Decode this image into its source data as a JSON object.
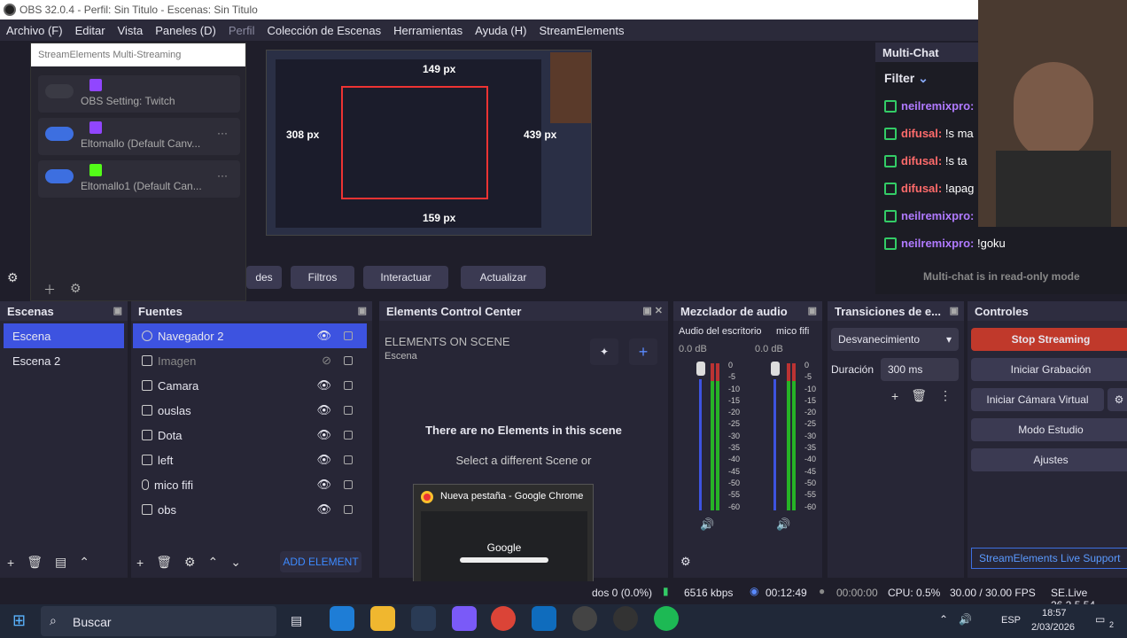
{
  "title": "OBS 32.0.4 - Perfil: Sin Titulo - Escenas: Sin Titulo",
  "menu": [
    "Archivo (F)",
    "Editar",
    "Vista",
    "Paneles (D)",
    "Perfil",
    "Colección de Escenas",
    "Herramientas",
    "Ayuda (H)",
    "StreamElements"
  ],
  "multistream": {
    "title": "StreamElements Multi-Streaming",
    "rows": [
      {
        "label": "OBS Setting: Twitch"
      },
      {
        "label": "Eltomallo (Default Canv..."
      },
      {
        "label": "Eltomallo1 (Default Can..."
      }
    ]
  },
  "preview": {
    "labels": [
      "149 px",
      "308 px",
      "439 px",
      "159 px"
    ]
  },
  "toolbar": {
    "props": "des",
    "filters": "Filtros",
    "interact": "Interactuar",
    "refresh": "Actualizar"
  },
  "chat": {
    "title": "Multi-Chat",
    "filter": "Filter",
    "lines": [
      {
        "user": "neilremixpro:",
        "msg": ""
      },
      {
        "user": "difusal:",
        "msg": "!s ma"
      },
      {
        "user": "difusal:",
        "msg": "!s ta"
      },
      {
        "user": "difusal:",
        "msg": "!apag"
      },
      {
        "user": "neilremixpro:",
        "msg": ""
      },
      {
        "user": "neilremixpro:",
        "msg": "!goku"
      }
    ],
    "readonly": "Multi-chat is in read-only mode"
  },
  "scenes": {
    "title": "Escenas",
    "items": [
      "Escena",
      "Escena 2"
    ]
  },
  "sources": {
    "title": "Fuentes",
    "items": [
      "Navegador 2",
      "Imagen",
      "Camara",
      "ouslas",
      "Dota",
      "left",
      "mico fifi",
      "obs"
    ]
  },
  "ecc": {
    "title": "Elements Control Center",
    "heading": "ELEMENTS ON SCENE",
    "scene": "Escena",
    "empty": "There are no Elements in this scene",
    "hint": "Select a different Scene or",
    "add": "ADD ELEMENT"
  },
  "chrome_popup": {
    "title": "Nueva pestaña - Google Chrome",
    "logo": "Google"
  },
  "mixer": {
    "title": "Mezclador de audio",
    "ch1": "Audio del escritorio",
    "ch2": "mico fifi",
    "db1": "0.0 dB",
    "db2": "0.0 dB",
    "scale": [
      "0",
      "-5",
      "-10",
      "-15",
      "-20",
      "-25",
      "-30",
      "-35",
      "-40",
      "-45",
      "-50",
      "-55",
      "-60"
    ]
  },
  "transitions": {
    "title": "Transiciones de e...",
    "type": "Desvanecimiento",
    "duration_label": "Duración",
    "duration": "300 ms"
  },
  "controls": {
    "title": "Controles",
    "stop": "Stop Streaming",
    "record": "Iniciar Grabación",
    "vcam": "Iniciar Cámara Virtual",
    "studio": "Modo Estudio",
    "settings": "Ajustes",
    "support": "StreamElements Live Support"
  },
  "status": {
    "dropped": "dos 0 (0.0%)",
    "kbps": "6516 kbps",
    "live": "00:12:49",
    "rec": "00:00:00",
    "cpu": "CPU: 0.5%",
    "fps": "30.00 / 30.00 FPS",
    "se": "SE.Live 26.2.5.54"
  },
  "taskbar": {
    "search": "Buscar",
    "lang": "ESP",
    "time": "18:57",
    "date": "2/03/2026",
    "notif": "2"
  },
  "colors": {
    "accent": "#3d53e0",
    "stop": "#c0392b",
    "twitch": "#9146ff",
    "kick": "#53fc18"
  }
}
